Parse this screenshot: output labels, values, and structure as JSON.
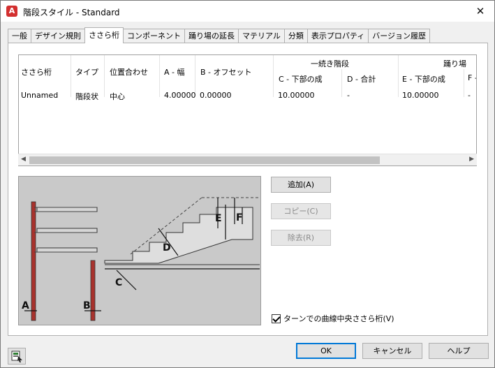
{
  "window": {
    "title": "階段スタイル - Standard",
    "app_icon_letter": "A",
    "close": "✕"
  },
  "tabs": [
    "一般",
    "デザイン規則",
    "ささら桁",
    "コンポーネント",
    "踊り場の延長",
    "マテリアル",
    "分類",
    "表示プロパティ",
    "バージョン履歴"
  ],
  "active_tab": "ささら桁",
  "grid": {
    "group_headers": {
      "flight": "一続き階段",
      "landing": "踊り場"
    },
    "columns": [
      "ささら桁",
      "タイプ",
      "位置合わせ",
      "A - 幅",
      "B - オフセット",
      "C - 下部の成",
      "D - 合計",
      "E - 下部の成",
      "F -"
    ],
    "row": [
      "Unnamed",
      "階段状",
      "中心",
      "4.00000",
      "0.00000",
      "10.00000",
      "-",
      "10.00000",
      "-"
    ]
  },
  "buttons": {
    "add": "追加(A)",
    "copy": "コピー(C)",
    "remove": "除去(R)",
    "ok": "OK",
    "cancel": "キャンセル",
    "help": "ヘルプ"
  },
  "checkbox": {
    "label": "ターンでの曲線中央ささら桁(V)",
    "checked": true
  },
  "diagram_labels": [
    "A",
    "B",
    "C",
    "D",
    "E",
    "F"
  ],
  "icons": {
    "bottom_left": "stair-style-icon"
  }
}
